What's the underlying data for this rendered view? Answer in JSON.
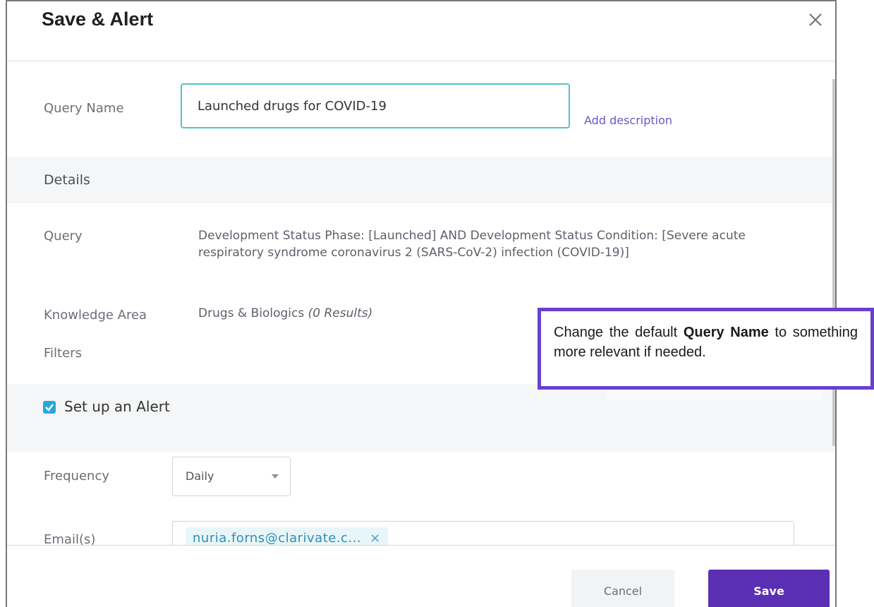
{
  "dialog": {
    "title": "Save & Alert",
    "close_icon": "close-icon"
  },
  "query_name": {
    "label": "Query Name",
    "value": "Launched drugs for COVID-19",
    "add_description": "Add description"
  },
  "details": {
    "heading": "Details",
    "query_label": "Query",
    "query_text": "Development Status Phase: [Launched] AND Development Status Condition: [Severe acute respiratory syndrome coronavirus 2 (SARS-CoV-2) infection (COVID-19)]",
    "knowledge_area_label": "Knowledge Area",
    "knowledge_area_value": "Drugs & Biologics",
    "knowledge_area_results": "(0 Results)",
    "filters_label": "Filters"
  },
  "alert": {
    "checkbox_label": "Set up an Alert",
    "checked": true,
    "frequency_label": "Frequency",
    "frequency_value": "Daily",
    "emails_label": "Email(s)",
    "email_chip": "nuria.forns@clarivate.c...",
    "chip_remove": "×"
  },
  "footer": {
    "cancel_label": "Cancel",
    "save_label": "Save"
  },
  "callout": {
    "text_before": "Change the default ",
    "bold": "Query Name",
    "text_after": " to something more relevant if needed."
  },
  "colors": {
    "accent": "#5b2fb3",
    "input_focus": "#54c3c6",
    "checkbox": "#2aa7d9",
    "callout_border": "#6a3fd0"
  }
}
